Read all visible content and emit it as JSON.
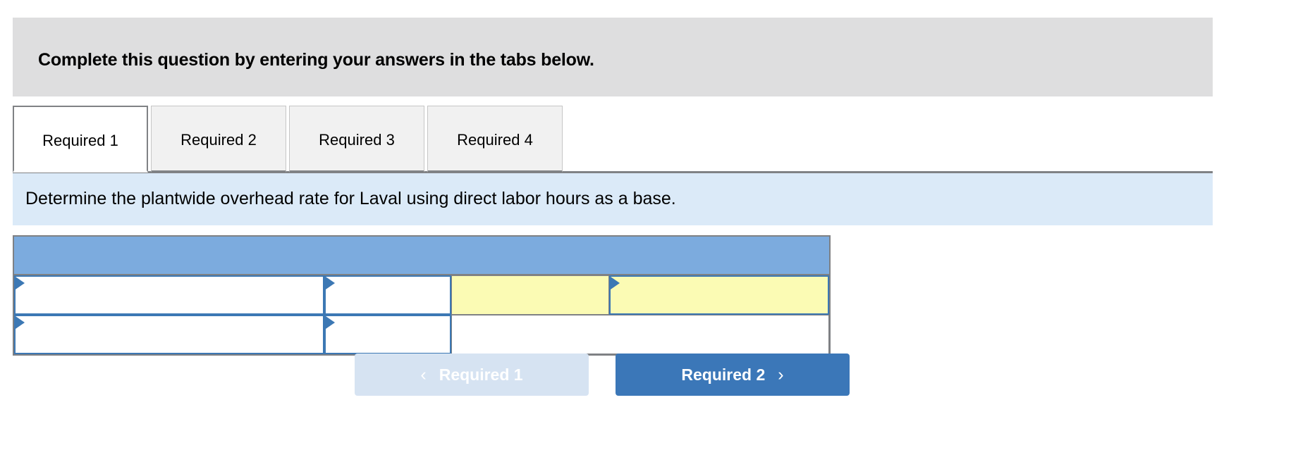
{
  "banner": {
    "text": "Complete this question by entering your answers in the tabs below."
  },
  "tabs": {
    "items": [
      {
        "label": "Required 1",
        "active": true
      },
      {
        "label": "Required 2",
        "active": false
      },
      {
        "label": "Required 3",
        "active": false
      },
      {
        "label": "Required 4",
        "active": false
      }
    ]
  },
  "requirement": {
    "text": "Determine the plantwide overhead rate for Laval using direct labor hours as a base."
  },
  "answer_table": {
    "header_row_label": "",
    "rows": [
      {
        "cells": [
          {
            "value": "",
            "type": "input",
            "fill": "white",
            "marker": "expand-triangle"
          },
          {
            "value": "",
            "type": "input",
            "fill": "white",
            "marker": "expand-triangle"
          },
          {
            "value": "",
            "type": "plain",
            "fill": "yellow",
            "marker": ""
          },
          {
            "value": "",
            "type": "input",
            "fill": "yellow",
            "marker": "expand-triangle"
          }
        ]
      },
      {
        "cells": [
          {
            "value": "",
            "type": "input",
            "fill": "white",
            "marker": "expand-triangle"
          },
          {
            "value": "",
            "type": "input",
            "fill": "white",
            "marker": "expand-triangle"
          },
          {
            "value": "",
            "type": "plain",
            "fill": "white",
            "marker": ""
          }
        ]
      }
    ]
  },
  "navigation": {
    "prev_label": "Required 1",
    "next_label": "Required 2",
    "prev_icon": "chevron-left-icon",
    "next_icon": "chevron-right-icon",
    "prev_chevron": "‹",
    "next_chevron": "›",
    "prev_disabled": true
  },
  "colors": {
    "banner_bg": "#dededf",
    "requirement_bg": "#dbeaf8",
    "table_header_bg": "#7cabde",
    "input_border": "#3c78b4",
    "input_yellow": "#fbfbb4",
    "table_border": "#7f8184",
    "next_button_bg": "#3b77b8",
    "prev_button_bg": "#d6e3f2"
  }
}
